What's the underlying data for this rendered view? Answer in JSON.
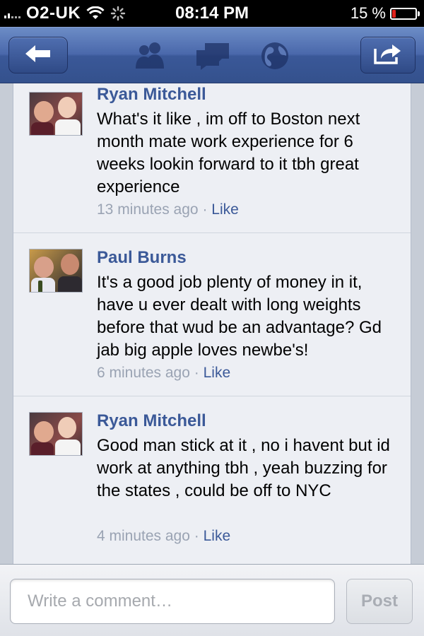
{
  "status_bar": {
    "carrier": "O2-UK",
    "time": "08:14 PM",
    "battery": "15 %",
    "battery_level": 0.15,
    "icons": [
      "signal-icon",
      "wifi-icon",
      "activity-spinner-icon",
      "battery-icon"
    ]
  },
  "nav": {
    "back_icon": "back-arrow-icon",
    "icons": [
      "friends-icon",
      "messages-icon",
      "globe-icon"
    ],
    "share_icon": "share-icon"
  },
  "comments": [
    {
      "author": "Ryan Mitchell",
      "text": "What's it like , im off to Boston next month mate work experience for 6 weeks lookin forward to it tbh great experience",
      "time": "13 minutes ago",
      "separator": "·",
      "like": "Like"
    },
    {
      "author": "Paul Burns",
      "text": "It's a good job plenty of money in it, have u ever dealt with long weights before that wud be an advantage? Gd jab big apple loves newbe's!",
      "time": "6 minutes ago",
      "separator": "·",
      "like": "Like"
    },
    {
      "author": "Ryan Mitchell",
      "text": "Good man stick at it , no i havent but id work at anything tbh , yeah buzzing for the states , could be off to NYC",
      "time": "4 minutes ago",
      "separator": "·",
      "like": "Like"
    }
  ],
  "composer": {
    "placeholder": "Write a comment…",
    "value": "",
    "post_label": "Post"
  },
  "colors": {
    "facebook_blue": "#3b5998",
    "battery_low": "#e0211b"
  }
}
